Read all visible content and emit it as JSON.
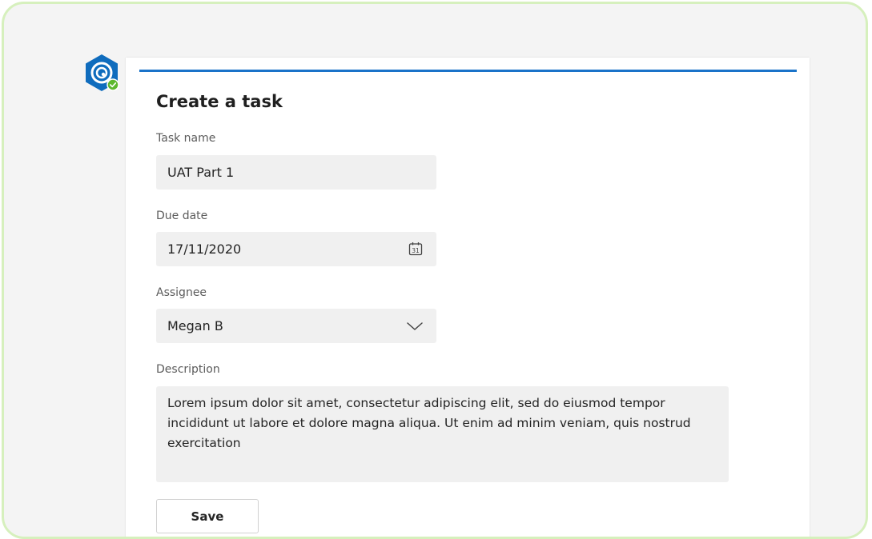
{
  "form": {
    "title": "Create a task",
    "task_name": {
      "label": "Task name",
      "value": "UAT Part 1"
    },
    "due_date": {
      "label": "Due date",
      "value": "17/11/2020",
      "icon": "calendar-icon",
      "icon_text": "31"
    },
    "assignee": {
      "label": "Assignee",
      "value": "Megan B",
      "icon": "chevron-down-icon"
    },
    "description": {
      "label": "Description",
      "value": "Lorem ipsum dolor sit amet, consectetur adipiscing elit, sed do eiusmod tempor incididunt ut labore et dolore magna aliqua. Ut enim ad minim veniam, quis nostrud exercitation"
    },
    "save_label": "Save"
  },
  "colors": {
    "accent": "#1a73c9",
    "frame_border": "#d6f0bd",
    "field_background": "#f0f0f0",
    "status_badge": "#5cb82e"
  },
  "app": {
    "icon": "app-logo-icon",
    "status_icon": "check-badge-icon"
  }
}
